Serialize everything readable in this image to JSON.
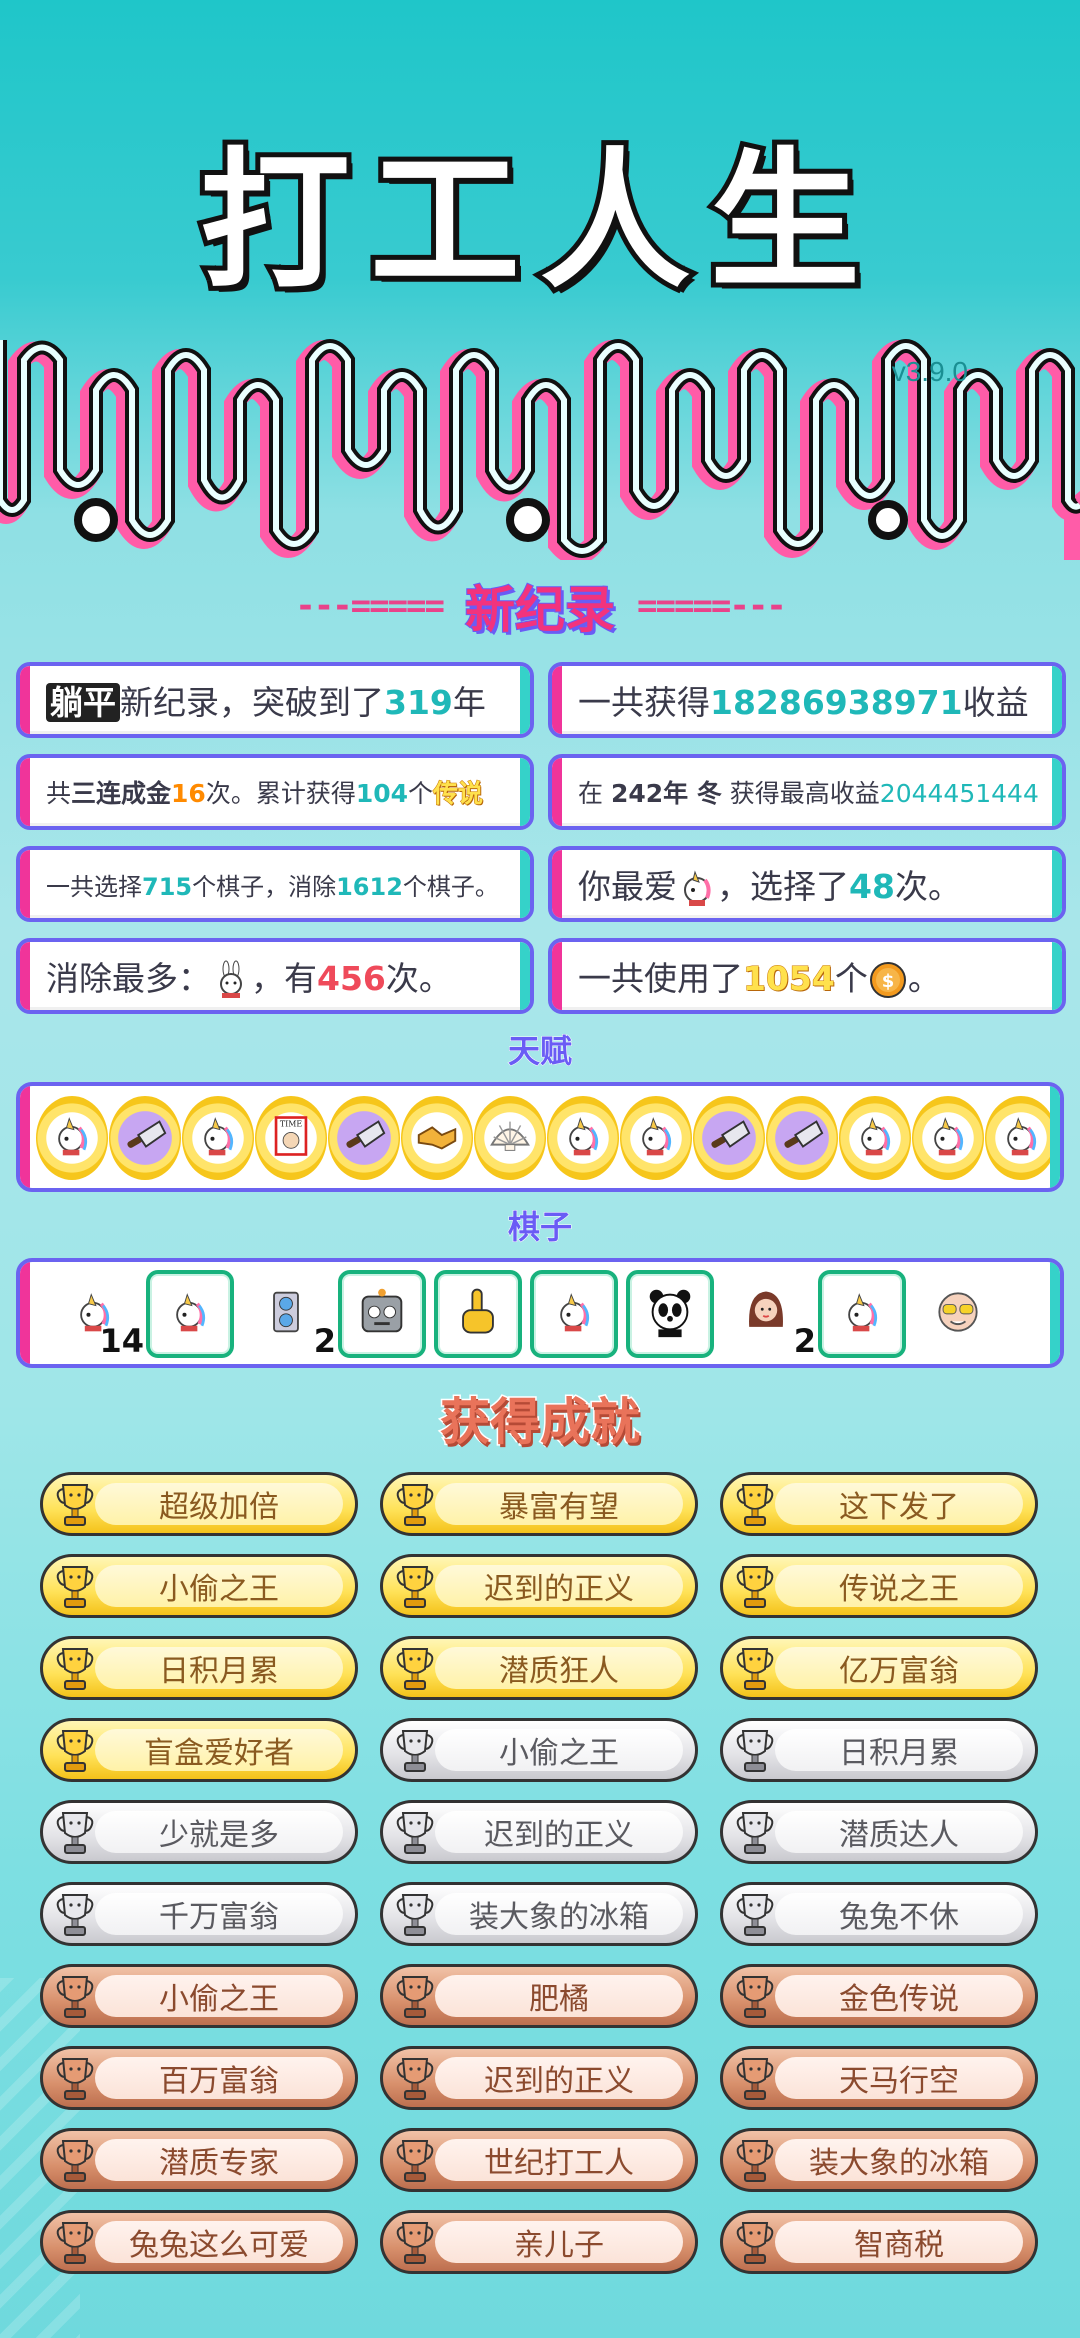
{
  "app": {
    "title": "打工人生",
    "version": "v3.9.0"
  },
  "records": {
    "heading": "新纪录",
    "dash_left": "---=====",
    "dash_right": "=====---",
    "cards": [
      {
        "tag": "躺平",
        "pre": "新纪录，突破到了",
        "value": "319",
        "post": "年"
      },
      {
        "pre": "一共获得",
        "value": "18286938971",
        "post": "收益"
      },
      {
        "pre": "共",
        "bold": "三连成金",
        "value": "16",
        "mid": "次。累计获得",
        "value2": "104",
        "mid2": "个",
        "tag": "传说"
      },
      {
        "pre": "在 ",
        "bold": "242年 冬",
        "mid": " 获得最高收益",
        "value": "2044451444"
      },
      {
        "pre": "一共选择",
        "value": "715",
        "mid": "个棋子，消除",
        "value2": "1612",
        "post": "个棋子。"
      },
      {
        "pre": "你最爱",
        "icon": "unicorn-icon",
        "mid": "，选择了",
        "value": "48",
        "post": "次。"
      },
      {
        "pre": "消除最多：",
        "icon": "rabbit-icon",
        "mid": "，有",
        "value": "456",
        "post": "次。"
      },
      {
        "pre": "一共使用了",
        "value": "1054",
        "mid": "个",
        "icon": "coin-icon",
        "post": "。"
      }
    ]
  },
  "talents": {
    "heading": "天赋",
    "items": [
      "unicorn-icon",
      "cleaver-icon",
      "unicorn-icon",
      "time-magazine-icon",
      "cleaver-icon",
      "handshake-icon",
      "shell-icon",
      "unicorn-icon",
      "unicorn-icon",
      "cleaver-icon",
      "cleaver-icon",
      "unicorn-icon",
      "unicorn-icon",
      "unicorn-icon"
    ]
  },
  "pieces": {
    "heading": "棋子",
    "items": [
      {
        "icon": "unicorn-icon",
        "count": "14",
        "boxed": false
      },
      {
        "icon": "unicorn-icon",
        "count": "",
        "boxed": true
      },
      {
        "icon": "gpu-icon",
        "count": "2",
        "boxed": false
      },
      {
        "icon": "robot-icon",
        "count": "",
        "boxed": true
      },
      {
        "icon": "pointing-hand-icon",
        "count": "",
        "boxed": true
      },
      {
        "icon": "unicorn-icon",
        "count": "",
        "boxed": true
      },
      {
        "icon": "panda-icon",
        "count": "",
        "boxed": true
      },
      {
        "icon": "woman-icon",
        "count": "2",
        "boxed": false
      },
      {
        "icon": "unicorn-icon",
        "count": "",
        "boxed": true
      },
      {
        "icon": "rich-face-icon",
        "count": "",
        "boxed": false
      }
    ]
  },
  "achievements": {
    "heading": "获得成就",
    "items": [
      {
        "label": "超级加倍",
        "tier": "gold"
      },
      {
        "label": "暴富有望",
        "tier": "gold"
      },
      {
        "label": "这下发了",
        "tier": "gold"
      },
      {
        "label": "小偷之王",
        "tier": "gold"
      },
      {
        "label": "迟到的正义",
        "tier": "gold"
      },
      {
        "label": "传说之王",
        "tier": "gold"
      },
      {
        "label": "日积月累",
        "tier": "gold"
      },
      {
        "label": "潜质狂人",
        "tier": "gold"
      },
      {
        "label": "亿万富翁",
        "tier": "gold"
      },
      {
        "label": "盲盒爱好者",
        "tier": "gold"
      },
      {
        "label": "小偷之王",
        "tier": "silver"
      },
      {
        "label": "日积月累",
        "tier": "silver"
      },
      {
        "label": "少就是多",
        "tier": "silver"
      },
      {
        "label": "迟到的正义",
        "tier": "silver"
      },
      {
        "label": "潜质达人",
        "tier": "silver"
      },
      {
        "label": "千万富翁",
        "tier": "silver"
      },
      {
        "label": "装大象的冰箱",
        "tier": "silver"
      },
      {
        "label": "兔兔不休",
        "tier": "silver"
      },
      {
        "label": "小偷之王",
        "tier": "bronze"
      },
      {
        "label": "肥橘",
        "tier": "bronze"
      },
      {
        "label": "金色传说",
        "tier": "bronze"
      },
      {
        "label": "百万富翁",
        "tier": "bronze"
      },
      {
        "label": "迟到的正义",
        "tier": "bronze"
      },
      {
        "label": "天马行空",
        "tier": "bronze"
      },
      {
        "label": "潜质专家",
        "tier": "bronze"
      },
      {
        "label": "世纪打工人",
        "tier": "bronze"
      },
      {
        "label": "装大象的冰箱",
        "tier": "bronze"
      },
      {
        "label": "兔兔这么可爱",
        "tier": "bronze"
      },
      {
        "label": "亲儿子",
        "tier": "bronze"
      },
      {
        "label": "智商税",
        "tier": "bronze"
      }
    ]
  }
}
